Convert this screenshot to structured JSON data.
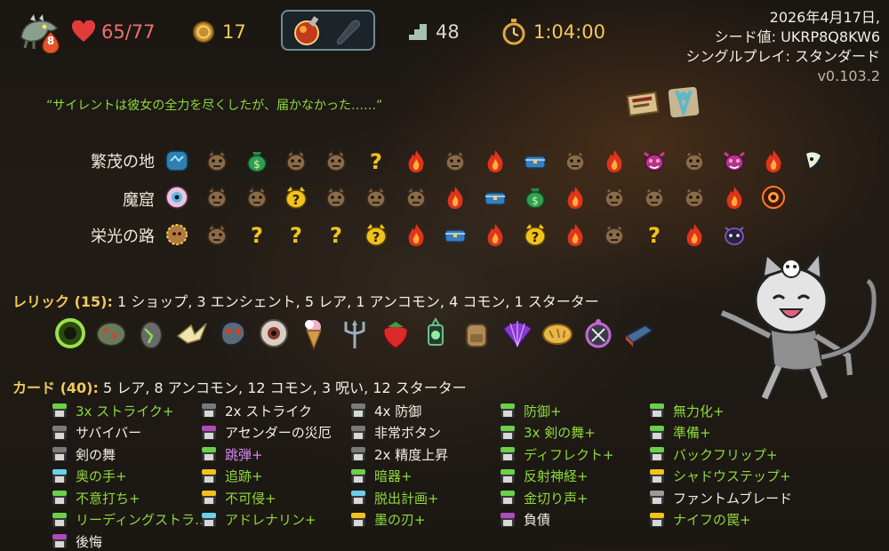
{
  "top_bar": {
    "ascension_level": "8",
    "hp": "65/77",
    "gold": "17",
    "floor": "48",
    "time": "1:04:00"
  },
  "run_info": {
    "date": "2026年4月17日,",
    "seed": "シード値: UKRP8Q8KW6",
    "mode": "シングルプレイ: スタンダード",
    "version": "v0.103.2"
  },
  "quote": "“サイレントは彼女の全力を尽くしたが、届かなかった……”",
  "map": {
    "acts": [
      {
        "label": "繁茂の地",
        "boss_icon": "glowing-boss-icon",
        "nodes": [
          "ancient",
          "monster",
          "merchant",
          "monster",
          "monster",
          "unknown",
          "rest",
          "monster",
          "rest",
          "treasure",
          "monster",
          "rest",
          "elite",
          "monster",
          "elite",
          "rest",
          "boss"
        ]
      },
      {
        "label": "魔窟",
        "boss_icon": "eye-boss-icon",
        "nodes": [
          "ancient",
          "monster",
          "monster",
          "unknown-fight",
          "monster",
          "monster",
          "monster",
          "rest",
          "treasure",
          "merchant",
          "rest",
          "monster",
          "monster",
          "monster",
          "rest",
          "boss"
        ]
      },
      {
        "label": "栄光の路",
        "boss_icon": "shadow-boss-icon",
        "nodes": [
          "ancient",
          "monster",
          "unknown",
          "unknown",
          "unknown",
          "unknown-fight",
          "rest",
          "treasure",
          "rest",
          "unknown-fight",
          "rest",
          "monster",
          "unknown",
          "rest",
          "boss"
        ]
      }
    ]
  },
  "relics": {
    "label": "レリック (15):",
    "summary": "1 ショップ,  3 エンシェント,  5 レア,  1 アンコモン,  4 コモン,  1 スターター",
    "items": [
      "snake-ring-icon",
      "green-stone-icon",
      "egg-icon",
      "paper-crane-icon",
      "dragon-head-icon",
      "eyeball-icon",
      "ice-cream-icon",
      "trident-icon",
      "strawberry-icon",
      "lantern-icon",
      "backpack-icon",
      "fan-icon",
      "bread-icon",
      "compass-icon",
      "whetstone-icon"
    ]
  },
  "cards": {
    "label": "カード (40):",
    "summary": "5 レア,  8 アンコモン,  12 コモン,  3 呪い,  12 スターター",
    "columns": [
      [
        {
          "name": "3x ストライク+",
          "style": "up",
          "rarity": "attack-up"
        },
        {
          "name": "サバイバー",
          "style": "norm",
          "rarity": "skill"
        },
        {
          "name": "剣の舞",
          "style": "norm",
          "rarity": "skill"
        },
        {
          "name": "奥の手+",
          "style": "up",
          "rarity": "rare-up"
        },
        {
          "name": "不意打ち+",
          "style": "up",
          "rarity": "skill-up"
        },
        {
          "name": "リーディングストラ…",
          "style": "up",
          "rarity": "skill-up"
        },
        {
          "name": "後悔",
          "style": "norm",
          "rarity": "curse"
        }
      ],
      [
        {
          "name": "2x ストライク",
          "style": "norm",
          "rarity": "attack"
        },
        {
          "name": "アセンダーの災厄",
          "style": "norm",
          "rarity": "curse"
        },
        {
          "name": "跳弾+",
          "style": "purple",
          "rarity": "attack-up"
        },
        {
          "name": "追跡+",
          "style": "up",
          "rarity": "uncommon-up"
        },
        {
          "name": "不可侵+",
          "style": "up",
          "rarity": "uncommon-up"
        },
        {
          "name": "アドレナリン+",
          "style": "up",
          "rarity": "rare-up"
        }
      ],
      [
        {
          "name": "4x 防御",
          "style": "norm",
          "rarity": "skill"
        },
        {
          "name": "非常ボタン",
          "style": "norm",
          "rarity": "skill"
        },
        {
          "name": "2x 精度上昇",
          "style": "norm",
          "rarity": "power"
        },
        {
          "name": "暗器+",
          "style": "up",
          "rarity": "skill-up"
        },
        {
          "name": "脱出計画+",
          "style": "up",
          "rarity": "rare-up"
        },
        {
          "name": "墨の刃+",
          "style": "up",
          "rarity": "uncommon-up"
        }
      ],
      [
        {
          "name": "防御+",
          "style": "up",
          "rarity": "skill-up"
        },
        {
          "name": "3x 剣の舞+",
          "style": "up",
          "rarity": "skill-up"
        },
        {
          "name": "ディフレクト+",
          "style": "up",
          "rarity": "skill-up"
        },
        {
          "name": "反射神経+",
          "style": "up",
          "rarity": "skill-up"
        },
        {
          "name": "金切り声+",
          "style": "up",
          "rarity": "skill-up"
        },
        {
          "name": "負債",
          "style": "norm",
          "rarity": "curse"
        }
      ],
      [
        {
          "name": "無力化+",
          "style": "up",
          "rarity": "skill-up"
        },
        {
          "name": "準備+",
          "style": "up",
          "rarity": "skill-up"
        },
        {
          "name": "バックフリップ+",
          "style": "up",
          "rarity": "skill-up"
        },
        {
          "name": "シャドウステップ+",
          "style": "up",
          "rarity": "uncommon-up"
        },
        {
          "name": "ファントムブレード",
          "style": "norm",
          "rarity": "rare"
        },
        {
          "name": "ナイフの罠+",
          "style": "up",
          "rarity": "uncommon-up"
        }
      ]
    ]
  },
  "colors": {
    "upgraded": "#8fd93b",
    "gold": "#f2c95a",
    "hp": "#f07070",
    "curse": "#d58cf2"
  }
}
